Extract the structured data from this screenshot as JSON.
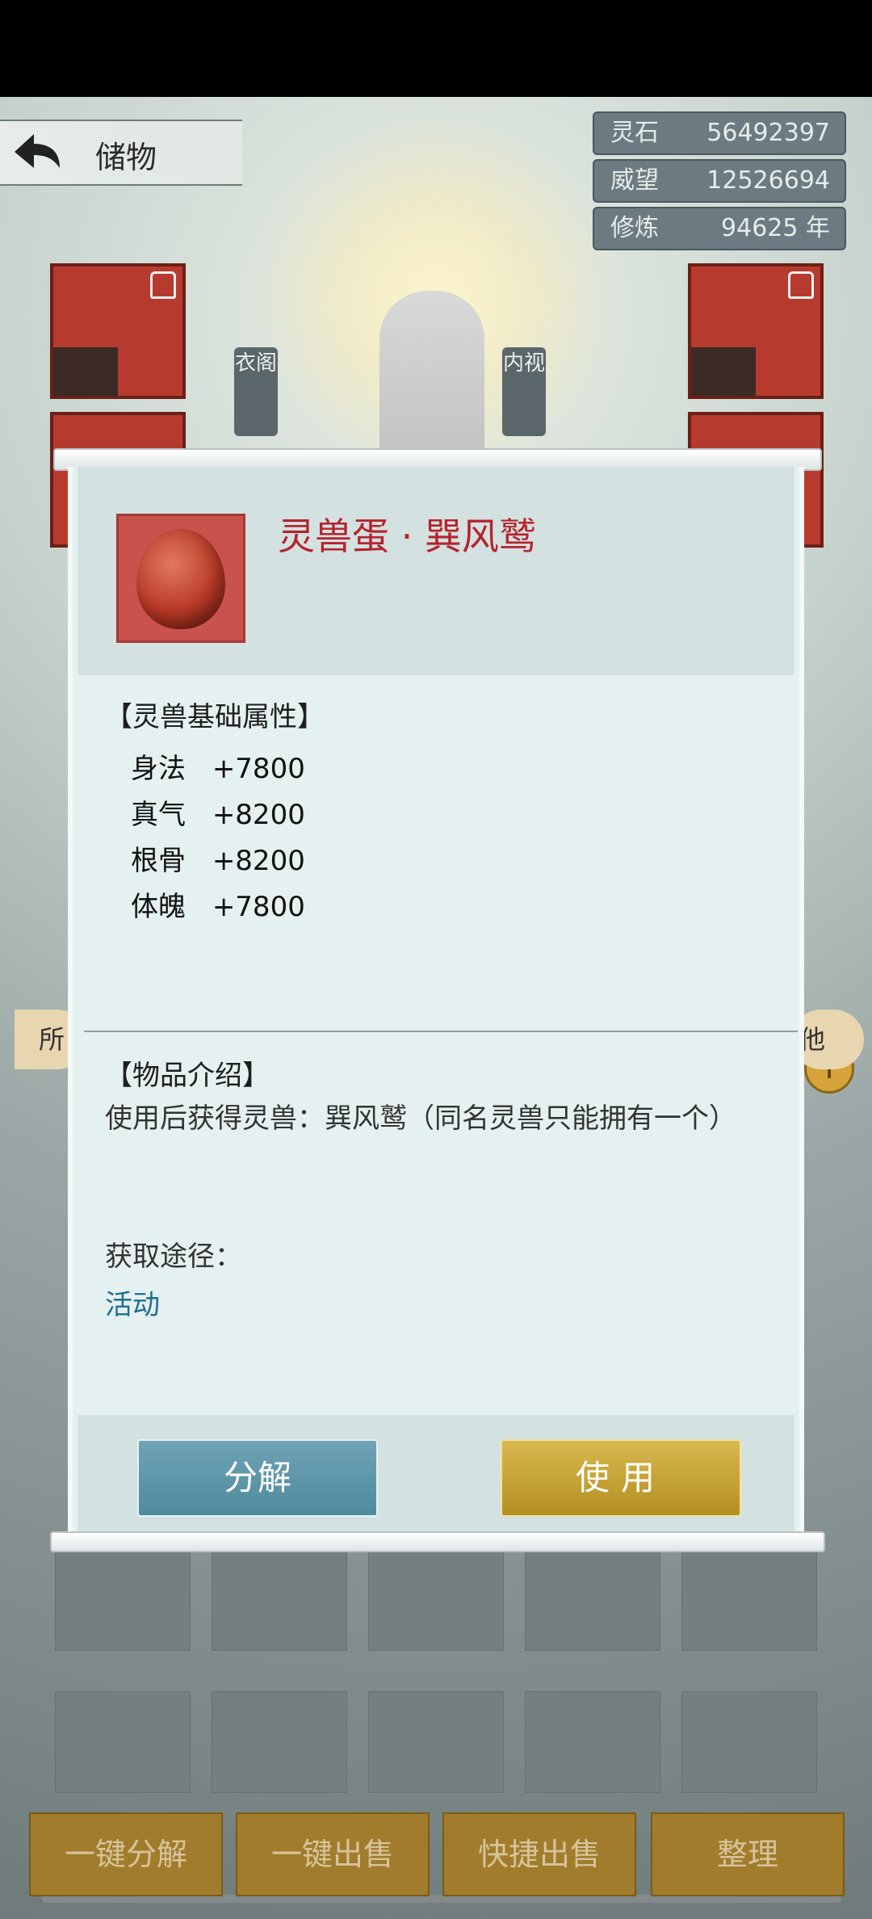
{
  "header": {
    "back_label": "储物"
  },
  "stats": [
    {
      "label": "灵石",
      "value": "56492397"
    },
    {
      "label": "威望",
      "value": "12526694"
    },
    {
      "label": "修炼",
      "value": "94625 年"
    }
  ],
  "side_tags": {
    "clothing": "衣阁",
    "inner_view": "内视"
  },
  "filters": {
    "left": "所",
    "right": "他"
  },
  "bottom_bar": {
    "decompose_all": "一键分解",
    "sell_all": "一键出售",
    "quick_sell": "快捷出售",
    "organize": "整理"
  },
  "modal": {
    "item_name": "灵兽蛋 · 巽风鹫",
    "attributes_title": "【灵兽基础属性】",
    "attributes": [
      {
        "name": "身法",
        "value": "+7800"
      },
      {
        "name": "真气",
        "value": "+8200"
      },
      {
        "name": "根骨",
        "value": "+8200"
      },
      {
        "name": "体魄",
        "value": "+7800"
      }
    ],
    "intro_title": "【物品介绍】",
    "intro_text": "使用后获得灵兽：巽风鹫（同名灵兽只能拥有一个）",
    "source_label": "获取途径：",
    "source_link": "活动",
    "decompose_button": "分解",
    "use_button": "使用"
  },
  "colors": {
    "item_name": "#b5232e",
    "link": "#1f6e93",
    "use_button": "#c9a43a",
    "decompose_button": "#5e97aa"
  }
}
